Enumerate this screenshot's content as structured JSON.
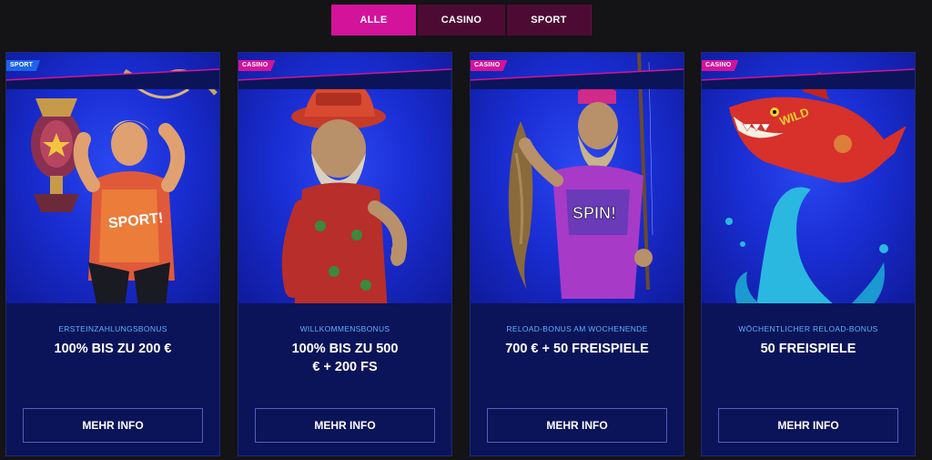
{
  "tabs": [
    {
      "label": "ALLE",
      "active": true
    },
    {
      "label": "CASINO",
      "active": false
    },
    {
      "label": "SPORT",
      "active": false
    }
  ],
  "cards": [
    {
      "badge": "SPORT",
      "subtitle": "ERSTEINZAHLUNGSBONUS",
      "headline": "100% BIS ZU 200 €",
      "button": "MEHR INFO",
      "art": "trophy-athlete"
    },
    {
      "badge": "CASINO",
      "subtitle": "WILLKOMMENSBONUS",
      "headline": "100% BIS ZU 500 € + 200 FS",
      "button": "MEHR INFO",
      "art": "bearded-man-thumbs-up"
    },
    {
      "badge": "CASINO",
      "subtitle": "RELOAD-BONUS AM WOCHENENDE",
      "headline": "700 € + 50 FREISPIELE",
      "button": "MEHR INFO",
      "art": "fisherman-spin"
    },
    {
      "badge": "CASINO",
      "subtitle": "WÖCHENTLICHER RELOAD-BONUS",
      "headline": "50 FREISPIELE",
      "button": "MEHR INFO",
      "art": "wild-shark"
    }
  ],
  "colors": {
    "accent": "#d3139a",
    "sport_badge": "#1e63e6",
    "card_bg": "#0b1459",
    "subtitle": "#5fb0ff"
  }
}
